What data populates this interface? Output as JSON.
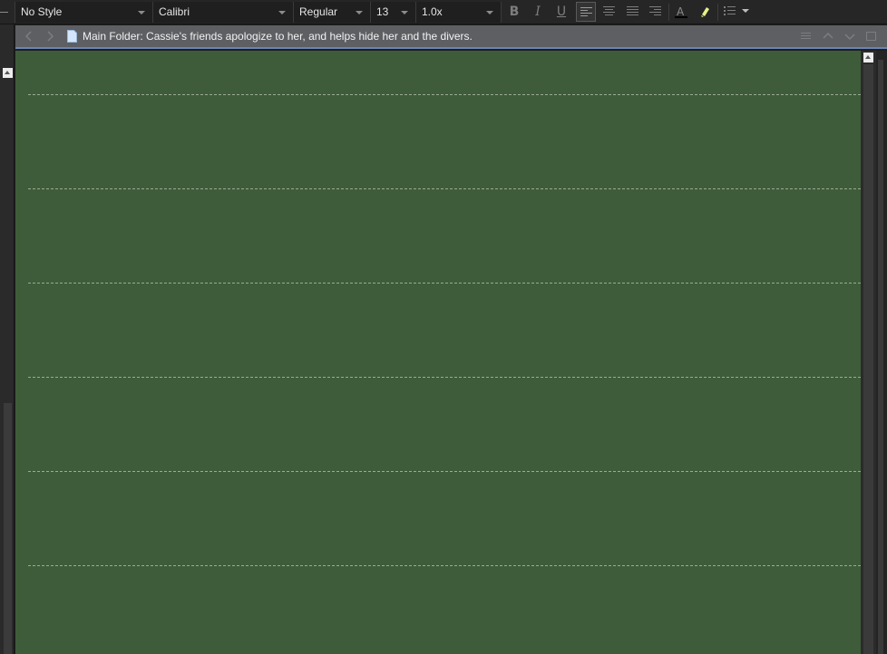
{
  "toolbar": {
    "style": "No Style",
    "font": "Calibri",
    "weight": "Regular",
    "size": "13",
    "line_spacing": "1.0x",
    "bold_label": "B",
    "italic_label": "I",
    "underline_label": "U"
  },
  "header": {
    "title": "Main Folder: Cassie's friends apologize to her, and helps hide her and the divers."
  },
  "editor": {
    "text": "",
    "background_color": "#3e5c39"
  },
  "colors": {
    "header_accent": "#6a85b5",
    "text_color_swatch": "#000000",
    "highlight_swatch": "#e8f08a"
  }
}
